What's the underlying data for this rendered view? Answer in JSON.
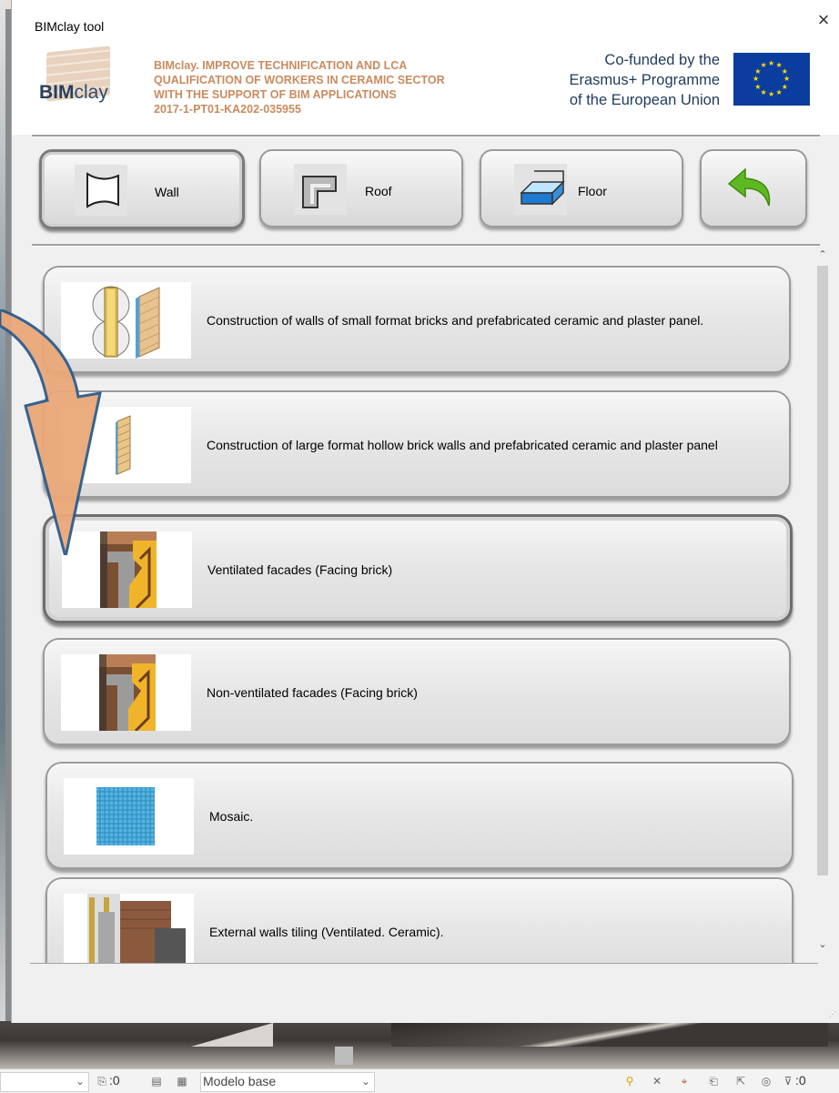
{
  "window": {
    "title": "BIMclay tool",
    "close_symbol": "×"
  },
  "header": {
    "logo_text_bold": "BIM",
    "logo_text_rest": "clay",
    "project_lines": [
      "BIMclay. IMPROVE TECHNIFICATION AND LCA",
      "QUALIFICATION OF WORKERS IN CERAMIC SECTOR",
      "WITH THE SUPPORT OF BIM APPLICATIONS",
      "2017-1-PT01-KA202-035955"
    ],
    "erasmus_lines": [
      "Co-funded by the",
      "Erasmus+ Programme",
      "of the European Union"
    ]
  },
  "categories": [
    {
      "label": "Wall",
      "icon": "wall-icon",
      "active": true
    },
    {
      "label": "Roof",
      "icon": "roof-icon",
      "active": false
    },
    {
      "label": "Floor",
      "icon": "floor-icon",
      "active": false
    },
    {
      "label": "",
      "icon": "back-arrow-icon",
      "active": false
    }
  ],
  "items": [
    {
      "label": "Construction of walls of small format bricks and prefabricated ceramic and plaster panel.",
      "icon": "small-brick-wall-icon",
      "selected": false
    },
    {
      "label": "Construction of large format hollow brick walls and prefabricated ceramic and plaster panel",
      "icon": "large-brick-wall-icon",
      "selected": false
    },
    {
      "label": "Ventilated facades (Facing brick)",
      "icon": "ventilated-facade-icon",
      "selected": true
    },
    {
      "label": "Non-ventilated facades (Facing brick)",
      "icon": "non-ventilated-facade-icon",
      "selected": false
    },
    {
      "label": "Mosaic.",
      "icon": "mosaic-icon",
      "selected": false
    },
    {
      "label": "External walls tiling (Ventilated. Ceramic).",
      "icon": "ventilated-tiling-icon",
      "selected": false
    }
  ],
  "statusbar": {
    "count_1": ":0",
    "model": "Modelo base",
    "count_2": ":0"
  },
  "colors": {
    "accent_orange": "#c98b5e",
    "eu_blue": "#0b3d9e",
    "eu_star": "#ffdd00",
    "back_arrow_green": "#5fb822",
    "erasmus_text": "#1f3a5c"
  }
}
